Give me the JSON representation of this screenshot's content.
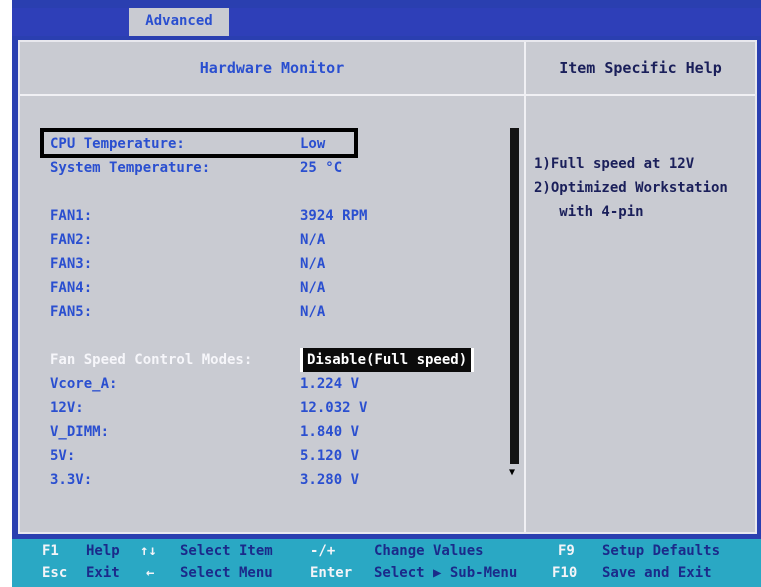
{
  "tab": {
    "label": "Advanced"
  },
  "header": {
    "main_title": "Hardware Monitor",
    "help_title": "Item Specific Help"
  },
  "rows": [
    {
      "label": "CPU  Temperature:",
      "value": "Low"
    },
    {
      "label": "System Temperature:",
      "value": "25 °C"
    },
    {
      "label": "FAN1:",
      "value": "3924 RPM"
    },
    {
      "label": "FAN2:",
      "value": "N/A"
    },
    {
      "label": "FAN3:",
      "value": "N/A"
    },
    {
      "label": "FAN4:",
      "value": "N/A"
    },
    {
      "label": "FAN5:",
      "value": "N/A"
    },
    {
      "label": "Fan Speed Control Modes:",
      "value": "Disable(Full speed)"
    },
    {
      "label": "Vcore_A:",
      "value": "1.224 V"
    },
    {
      "label": "12V:",
      "value": "12.032 V"
    },
    {
      "label": "V_DIMM:",
      "value": "1.840 V"
    },
    {
      "label": "5V:",
      "value": "5.120 V"
    },
    {
      "label": "3.3V:",
      "value": "3.280 V"
    }
  ],
  "help": {
    "lines": [
      "1)Full speed at 12V",
      "2)Optimized Workstation",
      "   with 4-pin"
    ]
  },
  "footer": {
    "row1": [
      {
        "key": "F1",
        "desc": "Help"
      },
      {
        "key": "↑↓",
        "desc": "Select Item"
      },
      {
        "key": "-/+",
        "desc": "Change Values"
      },
      {
        "key": "F9",
        "desc": "Setup Defaults"
      }
    ],
    "row2": [
      {
        "key": "Esc",
        "desc": "Exit"
      },
      {
        "key": "←",
        "desc": "Select Menu"
      },
      {
        "key": "Enter",
        "desc": "Select ▶ Sub-Menu"
      },
      {
        "key": "F10",
        "desc": "Save and Exit"
      }
    ]
  },
  "colors": {
    "screen_blue": "#2a3fb0",
    "panel_gray": "#c9cbd2",
    "item_blue": "#2a4fd0",
    "footer_cyan": "#2aa8c4"
  }
}
